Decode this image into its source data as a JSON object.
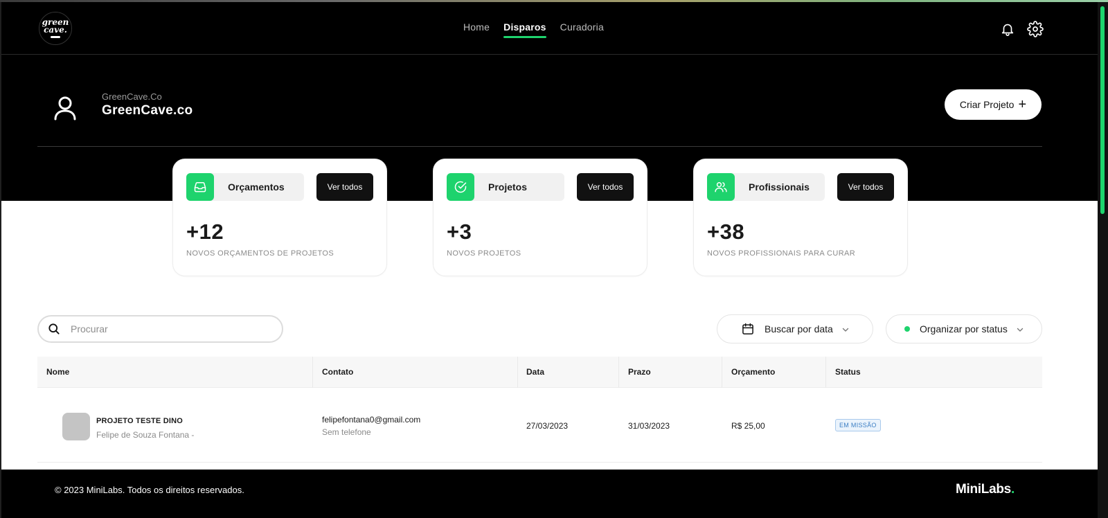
{
  "logo": {
    "line1": "green",
    "line2": "cave."
  },
  "nav": {
    "items": [
      {
        "label": "Home",
        "active": false
      },
      {
        "label": "Disparos",
        "active": true
      },
      {
        "label": "Curadoria",
        "active": false
      }
    ]
  },
  "icons": {
    "notifications": "bell-icon",
    "settings": "gear-icon",
    "profile": "user-icon"
  },
  "org": {
    "small_name": "GreenCave.Co",
    "name": "GreenCave.co"
  },
  "create_button": {
    "label": "Criar Projeto",
    "icon": "+"
  },
  "cards": [
    {
      "title": "Orçamentos",
      "icon": "inbox-icon",
      "button": "Ver todos",
      "value": "+12",
      "caption": "NOVOS ORÇAMENTOS DE PROJETOS"
    },
    {
      "title": "Projetos",
      "icon": "check-circle-icon",
      "button": "Ver todos",
      "value": "+3",
      "caption": "NOVOS PROJETOS"
    },
    {
      "title": "Profissionais",
      "icon": "users-icon",
      "button": "Ver todos",
      "value": "+38",
      "caption": "NOVOS PROFISSIONAIS PARA CURAR"
    }
  ],
  "search": {
    "placeholder": "Procurar",
    "value": ""
  },
  "filters": {
    "date_label": "Buscar por data",
    "status_label": "Organizar por status"
  },
  "table": {
    "columns": [
      "Nome",
      "Contato",
      "Data",
      "Prazo",
      "Orçamento",
      "Status"
    ],
    "rows": [
      {
        "name": "PROJETO TESTE DINO",
        "owner": "Felipe de Souza Fontana -",
        "email": "felipefontana0@gmail.com",
        "phone": "Sem telefone",
        "date": "27/03/2023",
        "deadline": "31/03/2023",
        "budget": "R$ 25,00",
        "status": "EM MISSÃO"
      }
    ]
  },
  "footer": {
    "copyright": "© 2023 MiniLabs. Todos os direitos reservados.",
    "brand": "MiniLabs",
    "brand_dot": "."
  },
  "colors": {
    "accent": "#1ed36d",
    "dark": "#000000",
    "status_badge": "#3d7fc4"
  }
}
